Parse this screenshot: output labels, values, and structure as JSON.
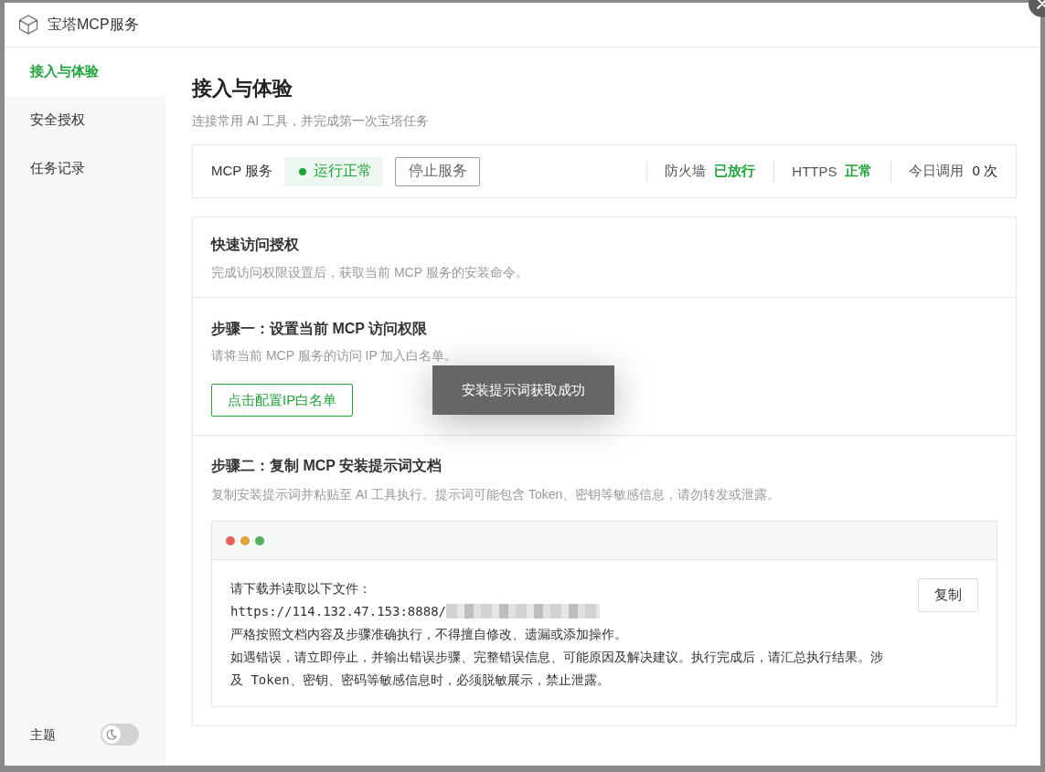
{
  "dialog": {
    "title": "宝塔MCP服务"
  },
  "sidebar": {
    "items": [
      {
        "label": "接入与体验",
        "selected": true
      },
      {
        "label": "安全授权",
        "selected": false
      },
      {
        "label": "任务记录",
        "selected": false
      }
    ],
    "theme": {
      "label": "主题",
      "on": false
    }
  },
  "page": {
    "title": "接入与体验",
    "subtitle": "连接常用 AI 工具，并完成第一次宝塔任务"
  },
  "service_bar": {
    "label": "MCP 服务",
    "status": {
      "text": "运行正常",
      "running": true
    },
    "stop_button": "停止服务",
    "indicators": [
      {
        "kind": "status",
        "label": "防火墙",
        "value": "已放行"
      },
      {
        "kind": "status",
        "label": "HTTPS",
        "value": "正常"
      },
      {
        "kind": "count",
        "label": "今日调用",
        "value": "0 次"
      }
    ]
  },
  "auth_card": {
    "title": "快速访问授权",
    "description": "完成访问权限设置后，获取当前 MCP 服务的安装命令。",
    "steps": [
      {
        "kind": "button",
        "title": "步骤一：设置当前 MCP 访问权限",
        "description": "请将当前 MCP 服务的访问 IP 加入白名单。",
        "button": "点击配置IP白名单"
      },
      {
        "kind": "prompt",
        "title": "步骤二：复制 MCP 安装提示词文档",
        "description": "复制安装提示词并粘贴至 AI 工具执行。提示词可能包含 Token、密钥等敏感信息，请勿转发或泄露。",
        "prompt_lines": [
          {
            "kind": "text",
            "text": "请下载并读取以下文件："
          },
          {
            "kind": "url",
            "text": "https://114.132.47.153:8888/"
          },
          {
            "kind": "text",
            "text": "严格按照文档内容及步骤准确执行，不得擅自修改、遗漏或添加操作。"
          },
          {
            "kind": "text",
            "text": "如遇错误，请立即停止，并输出错误步骤、完整错误信息、可能原因及解决建议。执行完成后，请汇总执行结果。涉及 Token、密钥、密码等敏感信息时，必须脱敏展示，禁止泄露。"
          }
        ],
        "copy_button": "复制"
      }
    ]
  },
  "toast": {
    "text": "安装提示词获取成功"
  }
}
